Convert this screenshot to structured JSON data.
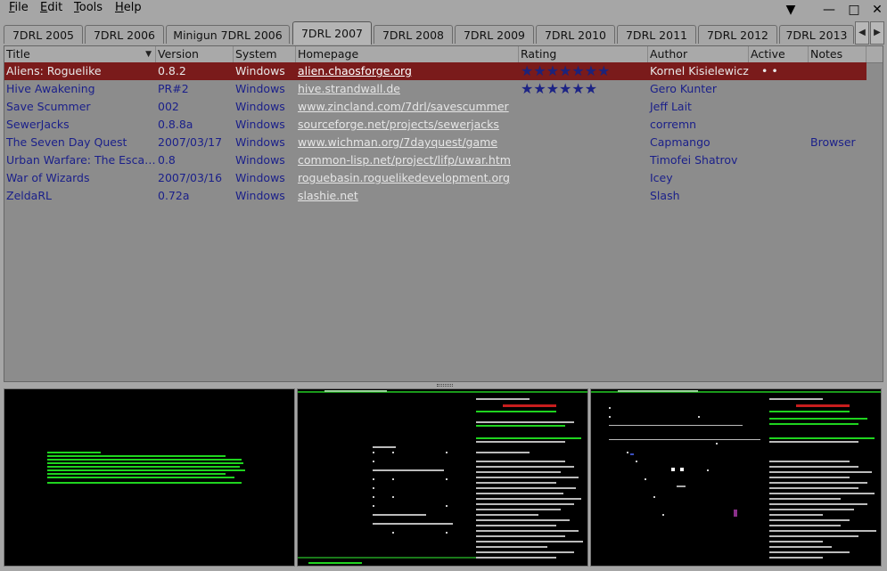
{
  "menu": [
    "File",
    "Edit",
    "Tools",
    "Help"
  ],
  "window_controls": {
    "menu": "▼",
    "minimize": "—",
    "maximize": "□",
    "close": "✕"
  },
  "tabs": [
    "7DRL 2005",
    "7DRL 2006",
    "Minigun 7DRL 2006",
    "7DRL 2007",
    "7DRL 2008",
    "7DRL 2009",
    "7DRL 2010",
    "7DRL 2011",
    "7DRL 2012",
    "7DRL 2013"
  ],
  "active_tab": "7DRL 2007",
  "tab_scroll": {
    "left": "◀",
    "right": "▶"
  },
  "table": {
    "columns": [
      "Title",
      "Version",
      "System",
      "Homepage",
      "Rating",
      "Author",
      "Active",
      "Notes"
    ],
    "sort_indicator": "▼",
    "rows": [
      {
        "title": "Aliens: Roguelike",
        "version": "0.8.2",
        "system": "Windows",
        "homepage": "alien.chaosforge.org",
        "rating": "★★★★★★★",
        "rating_value": 7.5,
        "author": "Kornel Kisielewicz",
        "active": "•  •",
        "notes": "",
        "selected": true
      },
      {
        "title": "Hive Awakening",
        "version": "PR#2",
        "system": "Windows",
        "homepage": "hive.strandwall.de",
        "rating": "★★★★★★",
        "rating_value": 6,
        "author": "Gero Kunter",
        "active": "",
        "notes": ""
      },
      {
        "title": "Save Scummer",
        "version": "002",
        "system": "Windows",
        "homepage": "www.zincland.com/7drl/savescummer",
        "rating": "",
        "author": "Jeff Lait",
        "active": "",
        "notes": ""
      },
      {
        "title": "SewerJacks",
        "version": "0.8.8a",
        "system": "Windows",
        "homepage": "sourceforge.net/projects/sewerjacks",
        "rating": "",
        "author": "corremn",
        "active": "",
        "notes": ""
      },
      {
        "title": "The Seven Day Quest",
        "version": "2007/03/17",
        "system": "Windows",
        "homepage": "www.wichman.org/7dayquest/game",
        "rating": "",
        "author": "Capmango",
        "active": "",
        "notes": "Browser"
      },
      {
        "title": "Urban Warfare: The Esca…",
        "version": "0.8",
        "system": "Windows",
        "homepage": "common-lisp.net/project/lifp/uwar.htm",
        "rating": "",
        "author": "Timofei Shatrov",
        "active": "",
        "notes": ""
      },
      {
        "title": "War of Wizards",
        "version": "2007/03/16",
        "system": "Windows",
        "homepage": "roguebasin.roguelikedevelopment.org",
        "rating": "",
        "author": "Icey",
        "active": "",
        "notes": ""
      },
      {
        "title": "ZeldaRL",
        "version": "0.72a",
        "system": "Windows",
        "homepage": "slashie.net",
        "rating": "",
        "author": "Slash",
        "active": "",
        "notes": ""
      }
    ]
  },
  "screenshots": [
    "screenshot-1",
    "screenshot-2",
    "screenshot-3"
  ],
  "colors": {
    "background": "#a6a6a6",
    "selected_row": "#7a1b1b",
    "text": "#1a1f8a",
    "terminal_green": "#1fd41f"
  }
}
